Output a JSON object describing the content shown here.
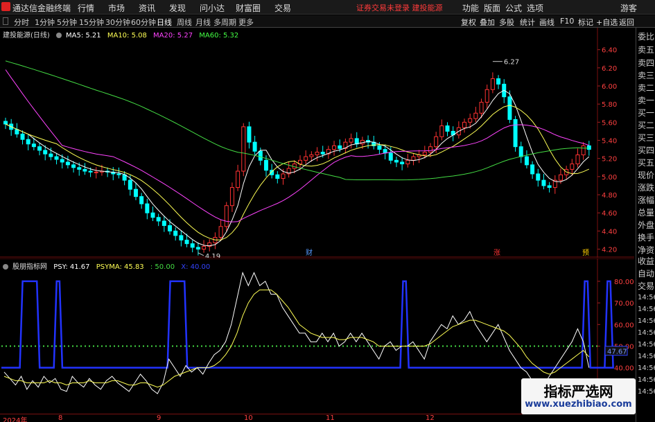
{
  "menubar": {
    "app_title": "通达信金融终端",
    "items": [
      "行情",
      "市场",
      "资讯",
      "发现",
      "问小达",
      "财富圈",
      "交易"
    ],
    "notice": "证券交易未登录  建投能源",
    "right_items": [
      "功能",
      "版面",
      "公式",
      "选项"
    ],
    "guest": "游客"
  },
  "toolbar": {
    "periods": [
      "分时",
      "1分钟",
      "5分钟",
      "15分钟",
      "30分钟",
      "60分钟",
      "日线",
      "周线",
      "月线",
      "多周期",
      "更多"
    ],
    "active_period": "日线",
    "tools": [
      "复权",
      "叠加",
      "多股",
      "统计",
      "画线",
      "F10",
      "标记",
      "+自选",
      "返回"
    ]
  },
  "main_chart": {
    "stock_label": "建投能源(日线)",
    "ma": [
      {
        "label": "MA5: 5.21",
        "color": "#ffffff"
      },
      {
        "label": "MA10: 5.08",
        "color": "#ffff55"
      },
      {
        "label": "MA20: 5.27",
        "color": "#ff44ff"
      },
      {
        "label": "MA60: 5.32",
        "color": "#44ff44"
      }
    ],
    "high_label": "6.27",
    "low_label": "4.19",
    "markers": [
      {
        "text": "财",
        "color": "#5599ff"
      },
      {
        "text": "涨",
        "color": "#ff3333"
      },
      {
        "text": "预",
        "color": "#ffcc00"
      }
    ]
  },
  "chart_data": {
    "type": "candlestick",
    "y_ticks": [
      "6.40",
      "6.20",
      "6.00",
      "5.80",
      "5.60",
      "5.40",
      "5.20",
      "5.00",
      "4.80",
      "4.60",
      "4.40",
      "4.20"
    ],
    "ylim": [
      4.12,
      6.52
    ],
    "high": 6.27,
    "low": 4.19,
    "closes": [
      5.58,
      5.52,
      5.47,
      5.41,
      5.36,
      5.33,
      5.29,
      5.25,
      5.22,
      5.19,
      5.16,
      5.13,
      5.1,
      5.08,
      5.06,
      5.05,
      5.05,
      5.06,
      5.05,
      5.03,
      5.02,
      4.96,
      4.86,
      4.78,
      4.7,
      4.6,
      4.55,
      4.51,
      4.46,
      4.4,
      4.35,
      4.3,
      4.26,
      4.22,
      4.2,
      4.23,
      4.27,
      4.33,
      4.45,
      4.68,
      4.88,
      5.06,
      5.55,
      5.38,
      5.28,
      5.18,
      5.07,
      5.02,
      4.98,
      5.03,
      5.09,
      5.14,
      5.18,
      5.22,
      5.24,
      5.27,
      5.25,
      5.3,
      5.34,
      5.31,
      5.38,
      5.42,
      5.36,
      5.4,
      5.38,
      5.34,
      5.3,
      5.26,
      5.18,
      5.16,
      5.14,
      5.18,
      5.22,
      5.24,
      5.27,
      5.33,
      5.44,
      5.56,
      5.5,
      5.46,
      5.54,
      5.6,
      5.64,
      5.7,
      5.82,
      5.96,
      6.08,
      6.02,
      5.88,
      5.63,
      5.33,
      5.22,
      5.13,
      5.03,
      4.96,
      4.9,
      4.88,
      4.96,
      5.02,
      5.08,
      5.14,
      5.24,
      5.34,
      5.3
    ],
    "series": [
      {
        "name": "MA5",
        "values": [
          5.21
        ]
      },
      {
        "name": "MA10",
        "values": [
          5.08
        ]
      },
      {
        "name": "MA20",
        "values": [
          5.27
        ]
      },
      {
        "name": "MA60",
        "values": [
          5.32
        ]
      }
    ]
  },
  "indicator": {
    "name": "股朋指标网",
    "psy": "PSY: 41.67",
    "psyma": "PSYMA: 45.83",
    "line50": ": 50.00",
    "line40": "X: 40.00",
    "y_ticks": [
      "80.00",
      "70.00",
      "60.00",
      "50.00",
      "40.00"
    ],
    "current_tag": "47.67",
    "psy_values": [
      38,
      35,
      32,
      36,
      30,
      34,
      31,
      36,
      33,
      35,
      30,
      29,
      36,
      33,
      31,
      35,
      32,
      30,
      34,
      36,
      33,
      31,
      29,
      33,
      37,
      34,
      30,
      28,
      33,
      44,
      40,
      36,
      41,
      38,
      40,
      37,
      42,
      46,
      48,
      52,
      60,
      72,
      84,
      78,
      84,
      78,
      80,
      74,
      74,
      68,
      64,
      60,
      56,
      56,
      52,
      52,
      56,
      52,
      56,
      50,
      52,
      56,
      52,
      56,
      52,
      48,
      44,
      50,
      52,
      48,
      50,
      50,
      52,
      48,
      44,
      52,
      56,
      60,
      58,
      64,
      60,
      62,
      66,
      60,
      56,
      52,
      56,
      60,
      54,
      48,
      44,
      40,
      38,
      34,
      30,
      32,
      36,
      40,
      44,
      48,
      52,
      58,
      52,
      40
    ],
    "psyma_values": [
      36,
      35,
      34,
      34,
      33,
      33,
      33,
      33,
      34,
      33,
      33,
      32,
      33,
      33,
      33,
      34,
      33,
      33,
      33,
      34,
      34,
      33,
      32,
      32,
      33,
      33,
      32,
      31,
      32,
      34,
      36,
      37,
      38,
      39,
      40,
      40,
      40,
      41,
      43,
      46,
      50,
      56,
      64,
      70,
      74,
      76,
      76,
      76,
      74,
      71,
      68,
      64,
      60,
      58,
      56,
      55,
      54,
      54,
      54,
      53,
      53,
      54,
      54,
      54,
      53,
      52,
      50,
      50,
      50,
      50,
      50,
      50,
      50,
      50,
      50,
      51,
      53,
      55,
      57,
      59,
      60,
      61,
      62,
      62,
      61,
      60,
      59,
      58,
      57,
      55,
      52,
      49,
      45,
      42,
      40,
      38,
      37,
      38,
      40,
      42,
      44,
      46,
      48,
      45
    ],
    "blue_pulses": [
      [
        3,
        6
      ],
      [
        9,
        10
      ],
      [
        29,
        32
      ],
      [
        70,
        71
      ],
      [
        102,
        103
      ],
      [
        106,
        107
      ]
    ]
  },
  "sidebar": {
    "items": [
      "委比",
      "卖五",
      "卖四",
      "卖三",
      "卖二",
      "卖一",
      "买一",
      "买二",
      "买三",
      "买四",
      "买五",
      "现价",
      "涨跌",
      "涨幅",
      "总量",
      "外盘",
      "换手",
      "净资",
      "收益",
      "自动",
      "交易"
    ],
    "times": [
      "14:56",
      "14:56",
      "14:56",
      "14:56",
      "14:56",
      "14:56",
      "14:56",
      "14:56",
      "14:56"
    ]
  },
  "date_axis": [
    "2024年",
    "8",
    "9",
    "10",
    "11",
    "12"
  ],
  "watermark": {
    "title": "指标严选网",
    "url": "www.xuezhibiao.com"
  }
}
